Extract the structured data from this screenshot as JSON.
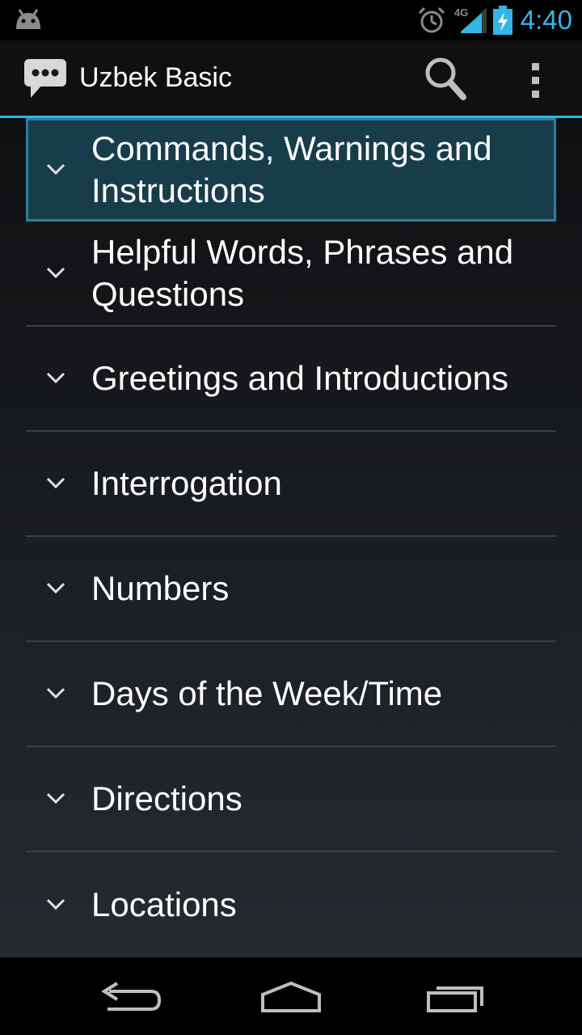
{
  "status_bar": {
    "time": "4:40",
    "network": "4G",
    "icons": [
      "android-icon",
      "alarm-icon",
      "signal-icon",
      "battery-charging-icon"
    ]
  },
  "action_bar": {
    "title": "Uzbek Basic",
    "app_icon": "chat-bubble-icon",
    "actions": [
      "search-icon",
      "overflow-menu-icon"
    ]
  },
  "categories": [
    {
      "label": "Commands, Warnings and Instructions",
      "selected": true
    },
    {
      "label": "Helpful Words, Phrases and Questions",
      "selected": false
    },
    {
      "label": "Greetings and Introductions",
      "selected": false
    },
    {
      "label": "Interrogation",
      "selected": false
    },
    {
      "label": "Numbers",
      "selected": false
    },
    {
      "label": "Days of the Week/Time",
      "selected": false
    },
    {
      "label": "Directions",
      "selected": false
    },
    {
      "label": "Locations",
      "selected": false
    }
  ],
  "nav_bar": {
    "buttons": [
      "back-icon",
      "home-icon",
      "recent-apps-icon"
    ]
  },
  "colors": {
    "accent": "#33b5e5",
    "selected_bg": "#173d4b",
    "selected_border": "#2a7fa0"
  }
}
